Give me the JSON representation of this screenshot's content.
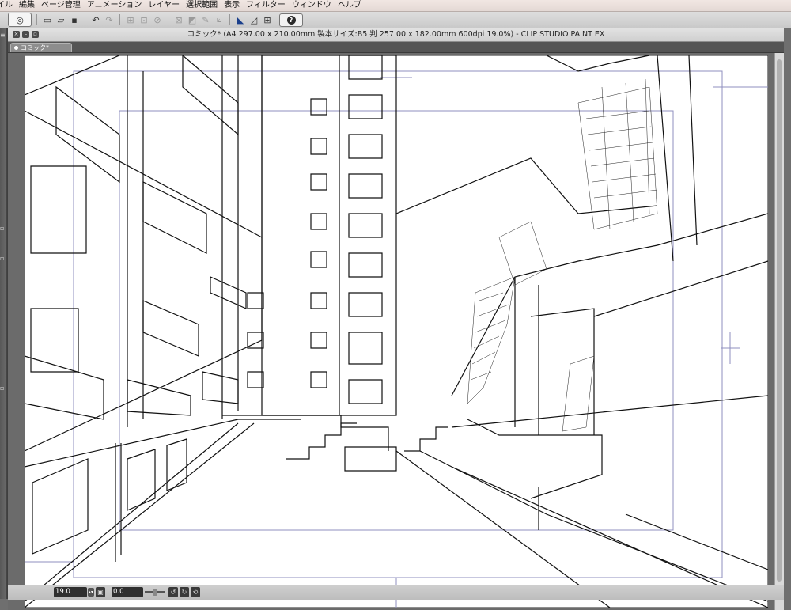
{
  "menu": {
    "items": [
      "イル",
      "編集",
      "ページ管理",
      "アニメーション",
      "レイヤー",
      "選択範囲",
      "表示",
      "フィルター",
      "ウィンドウ",
      "ヘルプ"
    ]
  },
  "toolbar": {
    "icons": [
      "clip-studio-logo-icon",
      "new-file-icon",
      "open-file-icon",
      "save-icon",
      "undo-icon",
      "redo-icon",
      "clear-icon",
      "transform-icon",
      "fill-icon",
      "snap-ruler-icon",
      "snap-special-ruler-icon",
      "snap-grid-icon",
      "help-icon"
    ]
  },
  "window": {
    "title": "コミック* (A4 297.00 x 210.00mm 製本サイズ:B5 判 257.00 x 182.00mm 600dpi 19.0%)  - CLIP STUDIO PAINT EX",
    "tab_label": "コミック*"
  },
  "status": {
    "zoom": "19.0",
    "rotation": "0.0"
  },
  "colors": {
    "menubar": "#e9dfdb",
    "canvas_bg": "#6b6b6b",
    "guide": "#8f8fbf",
    "paper": "#ffffff",
    "ink": "#111111"
  }
}
